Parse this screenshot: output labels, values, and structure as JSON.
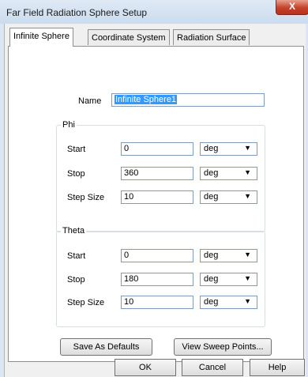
{
  "window": {
    "title": "Far Field Radiation Sphere Setup",
    "close_label": "X"
  },
  "tabs": [
    {
      "label": "Infinite Sphere"
    },
    {
      "label": "Coordinate System"
    },
    {
      "label": "Radiation Surface"
    }
  ],
  "name_field": {
    "label": "Name",
    "value": "Infinite Sphere1"
  },
  "phi": {
    "title": "Phi",
    "start": {
      "label": "Start",
      "value": "0",
      "unit": "deg"
    },
    "stop": {
      "label": "Stop",
      "value": "360",
      "unit": "deg"
    },
    "step": {
      "label": "Step Size",
      "value": "10",
      "unit": "deg"
    }
  },
  "theta": {
    "title": "Theta",
    "start": {
      "label": "Start",
      "value": "0",
      "unit": "deg"
    },
    "stop": {
      "label": "Stop",
      "value": "180",
      "unit": "deg"
    },
    "step": {
      "label": "Step Size",
      "value": "10",
      "unit": "deg"
    }
  },
  "buttons": {
    "save_defaults": "Save As Defaults",
    "view_sweep": "View Sweep Points...",
    "ok": "OK",
    "cancel": "Cancel",
    "help": "Help"
  }
}
